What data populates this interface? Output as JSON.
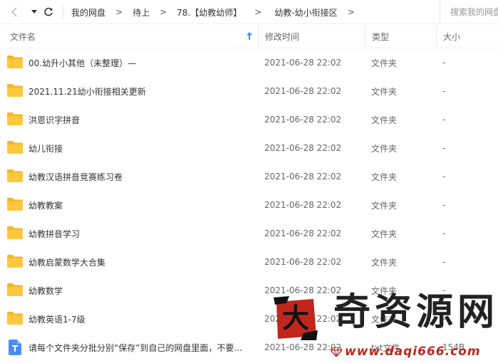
{
  "toolbar": {
    "breadcrumbs": [
      "我的网盘",
      "待上",
      "78.【幼教幼师】",
      "幼教-幼小衔接区"
    ],
    "search_placeholder": "搜索我的网盘文件"
  },
  "table": {
    "headers": {
      "name": "文件名",
      "modified": "修改时间",
      "type": "类型",
      "size": "大小"
    },
    "sort": "name-ascending",
    "rows": [
      {
        "icon": "folder-icon",
        "name": "00.幼升小其他（未整理）—",
        "modified": "2021-06-28 22:02",
        "type": "文件夹",
        "size": "-"
      },
      {
        "icon": "folder-icon",
        "name": "2021.11.21幼小衔接相关更新",
        "modified": "2021-06-28 22:02",
        "type": "文件夹",
        "size": "-"
      },
      {
        "icon": "folder-icon",
        "name": "洪恩识字拼音",
        "modified": "2021-06-28 22:02",
        "type": "文件夹",
        "size": "-"
      },
      {
        "icon": "folder-icon",
        "name": "幼儿衔接",
        "modified": "2021-06-28 22:02",
        "type": "文件夹",
        "size": "-"
      },
      {
        "icon": "folder-icon",
        "name": "幼教汉语拼音竞赛练习卷",
        "modified": "2021-06-28 22:02",
        "type": "文件夹",
        "size": "-"
      },
      {
        "icon": "folder-icon",
        "name": "幼教教案",
        "modified": "2021-06-28 22:02",
        "type": "文件夹",
        "size": "-"
      },
      {
        "icon": "folder-icon",
        "name": "幼教拼音学习",
        "modified": "2021-06-28 22:02",
        "type": "文件夹",
        "size": "-"
      },
      {
        "icon": "folder-icon",
        "name": "幼教启蒙数学大合集",
        "modified": "2021-06-28 22:02",
        "type": "文件夹",
        "size": "-"
      },
      {
        "icon": "folder-icon",
        "name": "幼教数学",
        "modified": "2021-06-28 22:02",
        "type": "文件夹",
        "size": "-"
      },
      {
        "icon": "folder-icon",
        "name": "幼教英语1-7级",
        "modified": "2021-06-28 22:02",
        "type": "文件夹",
        "size": "-"
      },
      {
        "icon": "txt-file-icon",
        "name": "请每个文件夹分批分别“保存”到自己的网盘里面，不要...",
        "modified": "2021-06-28 22:02",
        "type": "txt文件",
        "size": "154B"
      }
    ]
  },
  "watermark": {
    "seal_char": "大",
    "name": "奇资源网",
    "url": "www.daqi666.com"
  },
  "colors": {
    "folder": "#ffc73e",
    "folder_tab": "#f5b724",
    "txt_icon": "#4c8bf5",
    "sort_arrow": "#3b8cff",
    "watermark_red": "#c0261e"
  }
}
